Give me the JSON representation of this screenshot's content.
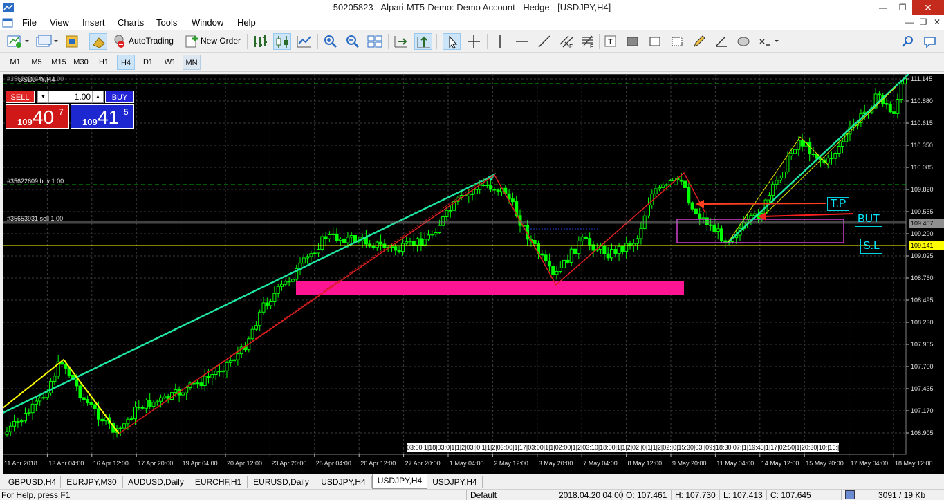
{
  "window": {
    "title": "50205823 - Alpari-MT5-Demo: Demo Account - Hedge - [USDJPY,H4]"
  },
  "menu": {
    "items": [
      "File",
      "View",
      "Insert",
      "Charts",
      "Tools",
      "Window",
      "Help"
    ]
  },
  "toolbar": {
    "autotrading_label": "AutoTrading",
    "new_order_label": "New Order"
  },
  "timeframes": {
    "items": [
      "M1",
      "M5",
      "M15",
      "M30",
      "H1",
      "H4",
      "D1",
      "W1",
      "MN"
    ],
    "selected": "H4",
    "highlighted": "MN"
  },
  "chart": {
    "symbol_label": "USDJPY,H4",
    "price_axis": [
      "111.145",
      "110.880",
      "110.615",
      "110.350",
      "110.085",
      "109.820",
      "109.555",
      "109.290",
      "109.025",
      "108.760",
      "108.495",
      "108.230",
      "107.965",
      "107.700",
      "107.435",
      "107.170",
      "106.905"
    ],
    "time_axis": [
      "11 Apr 2018",
      "13 Apr 04:00",
      "16 Apr 12:00",
      "17 Apr 20:00",
      "19 Apr 04:00",
      "20 Apr 12:00",
      "23 Apr 20:00",
      "25 Apr 04:00",
      "26 Apr 12:00",
      "27 Apr 20:00",
      "1 May 04:00",
      "2 May 12:00",
      "3 May 20:00",
      "7 May 04:00",
      "8 May 12:00",
      "9 May 20:00",
      "11 May 04:00",
      "14 May 12:00",
      "15 May 20:00",
      "17 May 04:00",
      "18 May 12:00"
    ],
    "current_bid_label": "109.407",
    "line_price_label": "109.141",
    "line_price_color": "#ffff00",
    "order_labels": [
      "#35620902 buy 1.00",
      "#35622609 buy 1.00",
      "#35653931 sell 1.00"
    ],
    "annotations": {
      "tp": "T.P",
      "buy": "BUT",
      "sl": "S.L"
    },
    "period_seps": "03:00|1|18|03:0|1|1|2|03:|0|1|1|2|03:00|1|17|03:00|1|1|02:00|1|2|03:10|18:00|1|1|2|02:|0|1|1|2|02:|0|15:30|03:|09:|18:30|07:|1|19:45|1|17|02:50|1|20:30|10:|16:|"
  },
  "one_click": {
    "sell_label": "SELL",
    "buy_label": "BUY",
    "volume": "1.00",
    "bid": {
      "prefix": "109",
      "big": "40",
      "sup": "7"
    },
    "ask": {
      "prefix": "109",
      "big": "41",
      "sup": "5"
    }
  },
  "tabs": [
    {
      "label": "GBPUSD,H4"
    },
    {
      "label": "EURJPY,M30"
    },
    {
      "label": "AUDUSD,Daily"
    },
    {
      "label": "EURCHF,H1"
    },
    {
      "label": "EURUSD,Daily"
    },
    {
      "label": "USDJPY,H4"
    },
    {
      "label": "USDJPY,H4"
    },
    {
      "label": "USDJPY,H4"
    }
  ],
  "selected_tab": 6,
  "status": {
    "help": "For Help, press F1",
    "profile": "Default",
    "datetime": "2018.04.20 04:00",
    "open": "O: 107.461",
    "high": "H: 107.730",
    "low": "L: 107.413",
    "close": "C: 107.645",
    "traffic": "3091 / 19 Kb"
  },
  "colors": {
    "chart_bg": "#000000",
    "candle": "#00ff00",
    "grid": "#3c3c3c",
    "zone": "#ff1493",
    "trendline": "#1ee6a0",
    "buy_line": "#00b000"
  }
}
